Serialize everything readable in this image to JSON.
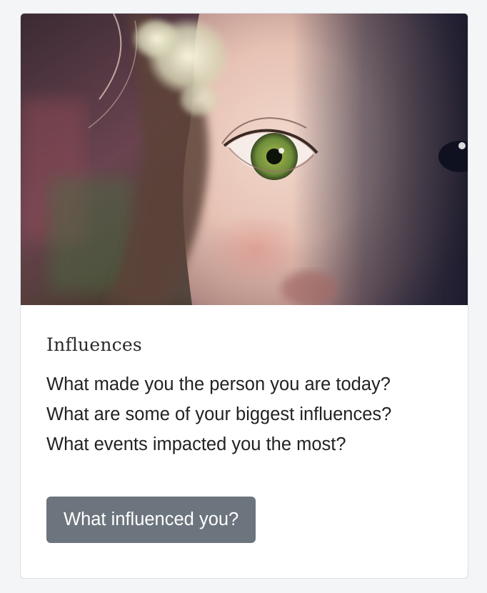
{
  "card": {
    "image_alt": "Close-up of a child's face with a green eye",
    "title": "Influences",
    "lines": [
      "What made you the person you are today?",
      "What are some of your biggest influences?",
      "What events impacted you the most?"
    ],
    "button_label": "What influenced you?"
  },
  "colors": {
    "button_bg": "#6c757d",
    "button_text": "#ffffff",
    "page_bg": "#f4f5f7",
    "card_border": "#dcdfe3"
  }
}
